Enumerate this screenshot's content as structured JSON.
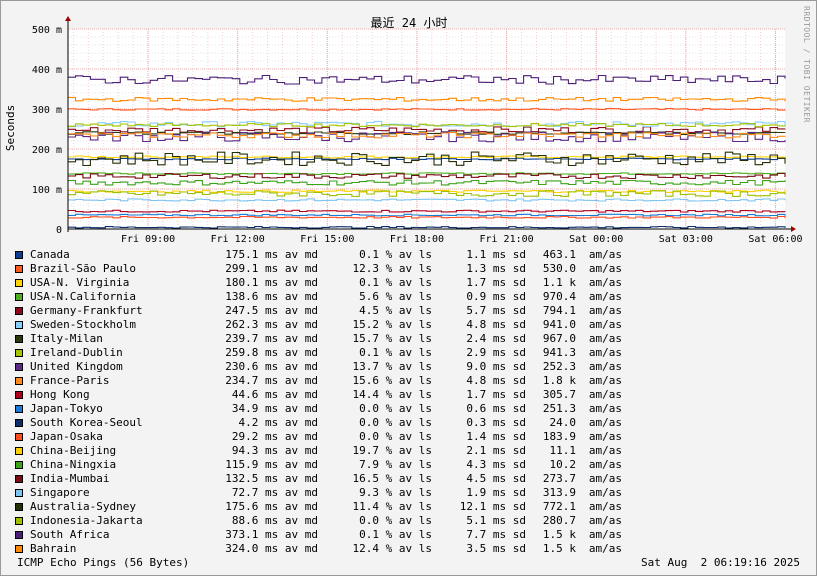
{
  "window": {
    "watermark": "RRDTOOL / TOBI OETIKER"
  },
  "chart_data": {
    "type": "line",
    "title": "最近 24 小时",
    "ylabel": "Seconds",
    "ylim": [
      0,
      0.5
    ],
    "yticks": [
      {
        "value": 0,
        "label": "0"
      },
      {
        "value": 0.1,
        "label": "100 m"
      },
      {
        "value": 0.2,
        "label": "200 m"
      },
      {
        "value": 0.3,
        "label": "300 m"
      },
      {
        "value": 0.4,
        "label": "400 m"
      },
      {
        "value": 0.5,
        "label": "500 m"
      }
    ],
    "xlim": [
      "Fri 06:19",
      "Sat 06:19"
    ],
    "xticks": [
      {
        "hour": 2.68,
        "label": "Fri 09:00"
      },
      {
        "hour": 5.68,
        "label": "Fri 12:00"
      },
      {
        "hour": 8.68,
        "label": "Fri 15:00"
      },
      {
        "hour": 11.68,
        "label": "Fri 18:00"
      },
      {
        "hour": 14.68,
        "label": "Fri 21:00"
      },
      {
        "hour": 17.68,
        "label": "Sat 00:00"
      },
      {
        "hour": 20.68,
        "label": "Sat 03:00"
      },
      {
        "hour": 23.68,
        "label": "Sat 06:00"
      }
    ],
    "grid": true,
    "legend_position": "bottom",
    "series": [
      {
        "name": "Canada",
        "color": "#0b3d91",
        "median": 175.1,
        "avg": "175.1 ms av md",
        "loss": "0.1 % av ls",
        "sd": "1.1 ms sd",
        "ratio": "463.1",
        "unit": "am/as"
      },
      {
        "name": "Brazil-São Paulo",
        "color": "#ff5a1f",
        "median": 299.1,
        "avg": "299.1 ms av md",
        "loss": "12.3 % av ls",
        "sd": "1.3 ms sd",
        "ratio": "530.0",
        "unit": "am/as"
      },
      {
        "name": "USA-N. Virginia",
        "color": "#ffd400",
        "median": 180.1,
        "avg": "180.1 ms av md",
        "loss": "0.1 % av ls",
        "sd": "1.7 ms sd",
        "ratio": "1.1 k",
        "unit": "am/as"
      },
      {
        "name": "USA-N.California",
        "color": "#4caf1f",
        "median": 138.6,
        "avg": "138.6 ms av md",
        "loss": "5.6 % av ls",
        "sd": "0.9 ms sd",
        "ratio": "970.4",
        "unit": "am/as"
      },
      {
        "name": "Germany-Frankfurt",
        "color": "#8b0a1e",
        "median": 247.5,
        "avg": "247.5 ms av md",
        "loss": "4.5 % av ls",
        "sd": "5.7 ms sd",
        "ratio": "794.1",
        "unit": "am/as"
      },
      {
        "name": "Sweden-Stockholm",
        "color": "#87cefa",
        "median": 262.3,
        "avg": "262.3 ms av md",
        "loss": "15.2 % av ls",
        "sd": "4.8 ms sd",
        "ratio": "941.0",
        "unit": "am/as"
      },
      {
        "name": "Italy-Milan",
        "color": "#2b3a0e",
        "median": 239.7,
        "avg": "239.7 ms av md",
        "loss": "15.7 % av ls",
        "sd": "2.4 ms sd",
        "ratio": "967.0",
        "unit": "am/as"
      },
      {
        "name": "Ireland-Dublin",
        "color": "#a4c400",
        "median": 259.8,
        "avg": "259.8 ms av md",
        "loss": "0.1 % av ls",
        "sd": "2.9 ms sd",
        "ratio": "941.3",
        "unit": "am/as"
      },
      {
        "name": "United Kingdom",
        "color": "#5b2a86",
        "median": 230.6,
        "avg": "230.6 ms av md",
        "loss": "13.7 % av ls",
        "sd": "9.0 ms sd",
        "ratio": "252.3",
        "unit": "am/as"
      },
      {
        "name": "France-Paris",
        "color": "#ff8c1a",
        "median": 234.7,
        "avg": "234.7 ms av md",
        "loss": "15.6 % av ls",
        "sd": "4.8 ms sd",
        "ratio": "1.8 k",
        "unit": "am/as"
      },
      {
        "name": "Hong Kong",
        "color": "#b00020",
        "median": 44.6,
        "avg": "44.6 ms av md",
        "loss": "14.4 % av ls",
        "sd": "1.7 ms sd",
        "ratio": "305.7",
        "unit": "am/as"
      },
      {
        "name": "Japan-Tokyo",
        "color": "#1a7bd6",
        "median": 34.9,
        "avg": "34.9 ms av md",
        "loss": "0.0 % av ls",
        "sd": "0.6 ms sd",
        "ratio": "251.3",
        "unit": "am/as"
      },
      {
        "name": "South Korea-Seoul",
        "color": "#0c2f6b",
        "median": 4.2,
        "avg": "4.2 ms av md",
        "loss": "0.0 % av ls",
        "sd": "0.3 ms sd",
        "ratio": "24.0",
        "unit": "am/as"
      },
      {
        "name": "Japan-Osaka",
        "color": "#ff4b1f",
        "median": 29.2,
        "avg": "29.2 ms av md",
        "loss": "0.0 % av ls",
        "sd": "1.4 ms sd",
        "ratio": "183.9",
        "unit": "am/as"
      },
      {
        "name": "China-Beijing",
        "color": "#ffd000",
        "median": 94.3,
        "avg": "94.3 ms av md",
        "loss": "19.7 % av ls",
        "sd": "2.1 ms sd",
        "ratio": "11.1",
        "unit": "am/as"
      },
      {
        "name": "China-Ningxia",
        "color": "#3aa31a",
        "median": 115.9,
        "avg": "115.9 ms av md",
        "loss": "7.9 % av ls",
        "sd": "4.3 ms sd",
        "ratio": "10.2",
        "unit": "am/as"
      },
      {
        "name": "India-Mumbai",
        "color": "#7a0a14",
        "median": 132.5,
        "avg": "132.5 ms av md",
        "loss": "16.5 % av ls",
        "sd": "4.5 ms sd",
        "ratio": "273.7",
        "unit": "am/as"
      },
      {
        "name": "Singapore",
        "color": "#7fc4f0",
        "median": 72.7,
        "avg": "72.7 ms av md",
        "loss": "9.3 % av ls",
        "sd": "1.9 ms sd",
        "ratio": "313.9",
        "unit": "am/as"
      },
      {
        "name": "Australia-Sydney",
        "color": "#263006",
        "median": 175.6,
        "avg": "175.6 ms av md",
        "loss": "11.4 % av ls",
        "sd": "12.1 ms sd",
        "ratio": "772.1",
        "unit": "am/as"
      },
      {
        "name": "Indonesia-Jakarta",
        "color": "#9dc000",
        "median": 88.6,
        "avg": "88.6 ms av md",
        "loss": "0.0 % av ls",
        "sd": "5.1 ms sd",
        "ratio": "280.7",
        "unit": "am/as"
      },
      {
        "name": "South Africa",
        "color": "#4b1e78",
        "median": 373.1,
        "avg": "373.1 ms av md",
        "loss": "0.1 % av ls",
        "sd": "7.7 ms sd",
        "ratio": "1.5 k",
        "unit": "am/as"
      },
      {
        "name": "Bahrain",
        "color": "#ff8a00",
        "median": 324.0,
        "avg": "324.0 ms av md",
        "loss": "12.4 % av ls",
        "sd": "3.5 ms sd",
        "ratio": "1.5 k",
        "unit": "am/as"
      }
    ]
  },
  "footer": {
    "left": "ICMP Echo Pings (56 Bytes)",
    "right": "Sat Aug  2 06:19:16 2025"
  }
}
